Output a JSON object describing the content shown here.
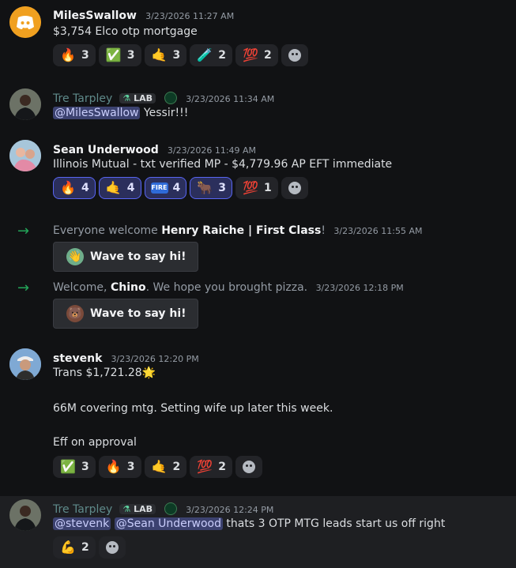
{
  "messages": [
    {
      "author": "MilesSwallow",
      "timestamp": "3/23/2026 11:27 AM",
      "text": "$3,754 Elco otp mortgage",
      "reactions": [
        {
          "emoji": "🔥",
          "count": "3"
        },
        {
          "emoji": "✅",
          "count": "3"
        },
        {
          "emoji": "🤙",
          "count": "3"
        },
        {
          "emoji": "🧪",
          "count": "2"
        },
        {
          "emoji": "💯",
          "count": "2"
        }
      ]
    },
    {
      "author": "Tre Tarpley",
      "role_tag": "LAB",
      "timestamp": "3/23/2026 11:34 AM",
      "mention": "@MilesSwallow",
      "text": " Yessir!!!"
    },
    {
      "author": "Sean Underwood",
      "timestamp": "3/23/2026 11:49 AM",
      "text": "Illinois Mutual - txt verified MP - $4,779.96 AP EFT immediate",
      "reactions": [
        {
          "emoji": "🔥",
          "count": "4"
        },
        {
          "emoji": "🤙",
          "count": "4"
        },
        {
          "emoji": "FIRE",
          "count": "4"
        },
        {
          "emoji": "🐂",
          "count": "3"
        },
        {
          "emoji": "💯",
          "count": "1"
        }
      ]
    },
    {
      "author": "stevenk",
      "timestamp": "3/23/2026 12:20 PM",
      "line1": "Trans $1,721.28",
      "line1_emoji": "🌟",
      "line2": "66M covering mtg. Setting wife up later this week.",
      "line3": "Eff on approval",
      "reactions": [
        {
          "emoji": "✅",
          "count": "3"
        },
        {
          "emoji": "🔥",
          "count": "3"
        },
        {
          "emoji": "🤙",
          "count": "2"
        },
        {
          "emoji": "💯",
          "count": "2"
        }
      ]
    },
    {
      "author": "Tre Tarpley",
      "role_tag": "LAB",
      "timestamp": "3/23/2026 12:24 PM",
      "mention1": "@stevenk",
      "mention2": "@Sean Underwood",
      "text": " thats 3 OTP MTG leads start us off right",
      "reactions": [
        {
          "emoji": "💪",
          "count": "2"
        }
      ]
    }
  ],
  "system": [
    {
      "prefix": "Everyone welcome ",
      "name": "Henry Raiche | First Class",
      "suffix": "!",
      "timestamp": "3/23/2026 11:55 AM",
      "button": "Wave to say hi!"
    },
    {
      "prefix": "Welcome, ",
      "name": "Chino",
      "suffix": ". We hope you brought pizza.",
      "timestamp": "3/23/2026 12:18 PM",
      "button": "Wave to say hi!"
    }
  ],
  "colors": {
    "background": "#111214",
    "accent": "#5865f2",
    "join_arrow": "#23a559"
  }
}
